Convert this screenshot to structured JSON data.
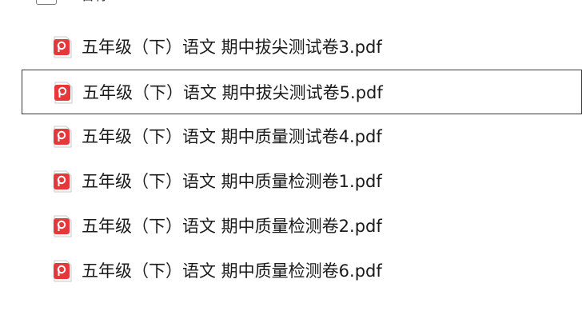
{
  "header": {
    "label": "名称"
  },
  "files": [
    {
      "name": "五年级（下）语文 期中拔尖测试卷3.pdf",
      "icon": "pdf-icon",
      "selected": false
    },
    {
      "name": "五年级（下）语文 期中拔尖测试卷5.pdf",
      "icon": "pdf-icon",
      "selected": true
    },
    {
      "name": "五年级（下）语文 期中质量测试卷4.pdf",
      "icon": "pdf-icon",
      "selected": false
    },
    {
      "name": "五年级（下）语文 期中质量检测卷1.pdf",
      "icon": "pdf-icon",
      "selected": false
    },
    {
      "name": "五年级（下）语文 期中质量检测卷2.pdf",
      "icon": "pdf-icon",
      "selected": false
    },
    {
      "name": "五年级（下）语文 期中质量检测卷6.pdf",
      "icon": "pdf-icon",
      "selected": false
    }
  ],
  "colors": {
    "pdf_red": "#e5383b",
    "selection_border": "#3a3a3a"
  }
}
